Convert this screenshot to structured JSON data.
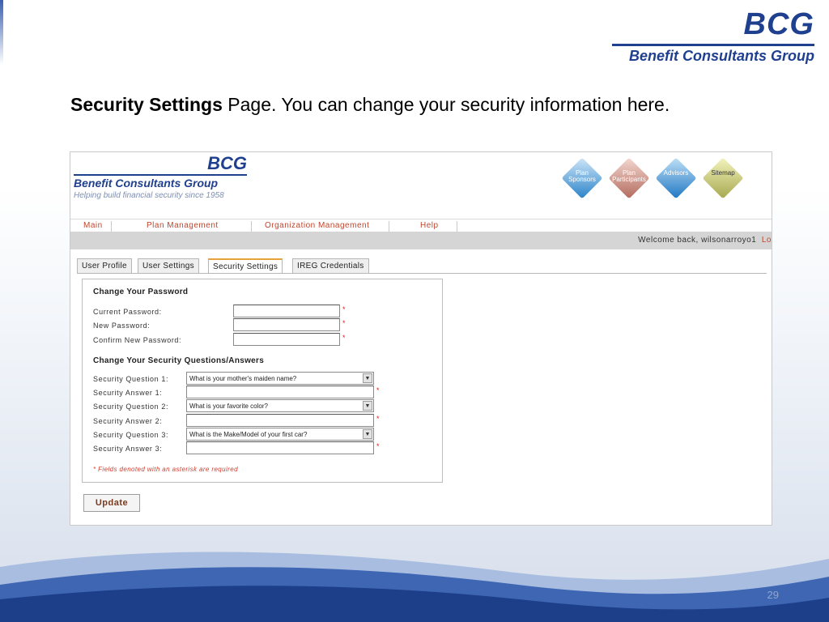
{
  "slide": {
    "logo_short": "BCG",
    "logo_name": "Benefit Consultants Group",
    "caption_bold": "Security Settings",
    "caption_rest": " Page.  You can change your security information here.",
    "page_number": "29"
  },
  "app": {
    "logo_short": "BCG",
    "logo_name": "Benefit Consultants Group",
    "tagline": "Helping build financial security since 1958",
    "nav_diamonds": [
      {
        "label": "Plan Sponsors"
      },
      {
        "label": "Plan Participants"
      },
      {
        "label": "Advisors"
      },
      {
        "label": "Sitemap"
      }
    ],
    "menu": [
      "Main",
      "Plan Management",
      "Organization Management",
      "Help"
    ],
    "welcome": "Welcome back, wilsonarroyo1",
    "logout_fragment": "Lo",
    "tabs": [
      "User Profile",
      "User Settings",
      "Security Settings",
      "IREG Credentials"
    ],
    "password_section": {
      "title": "Change Your Password",
      "current_label": "Current Password:",
      "new_label": "New Password:",
      "confirm_label": "Confirm New Password:"
    },
    "questions_section": {
      "title": "Change Your Security Questions/Answers",
      "q1_label": "Security Question 1:",
      "q1_value": "What is your mother's maiden name?",
      "a1_label": "Security Answer 1:",
      "q2_label": "Security Question 2:",
      "q2_value": "What is your favorite color?",
      "a2_label": "Security Answer 2:",
      "q3_label": "Security Question 3:",
      "q3_value": "What is the Make/Model of your first car?",
      "a3_label": "Security Answer 3:"
    },
    "required_marker": "*",
    "required_note": "* Fields denoted with an asterisk are required",
    "update_label": "Update"
  }
}
